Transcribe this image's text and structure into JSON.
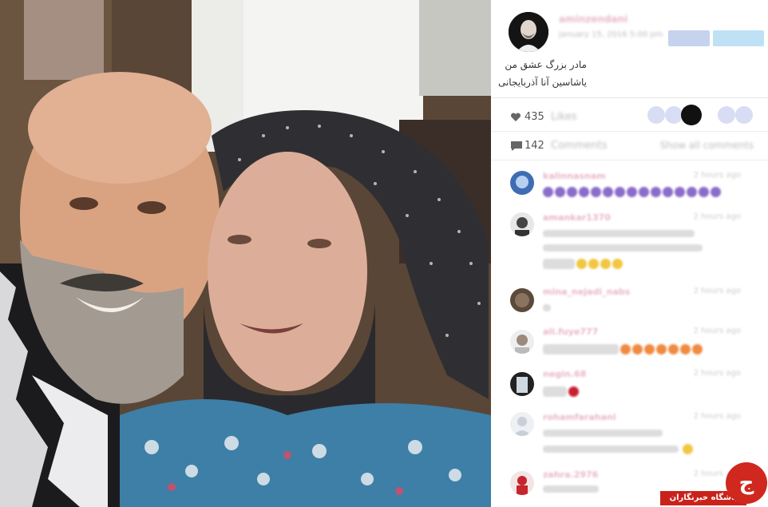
{
  "post": {
    "username": "aminzendani",
    "date": "January 15, 2016 5:00 pm",
    "caption": [
      "مادر بزرگ عشق من",
      "یاشاسین آنا آذربایجانی"
    ]
  },
  "stats": {
    "likes_count": "435",
    "likes_label": "Likes",
    "comments_count": "142",
    "comments_label": "Comments",
    "show_all_label": "Show all comments",
    "heart_icon": "heart-icon",
    "comment_icon": "comment-icon"
  },
  "comments": [
    {
      "username": "kalinnasnam",
      "time": "2 hours ago"
    },
    {
      "username": "amankar1370",
      "time": "2 hours ago"
    },
    {
      "username": "mina_nejadi_nabs",
      "time": "2 hours ago"
    },
    {
      "username": "ali.fuye777",
      "time": "2 hours ago"
    },
    {
      "username": "negin.68",
      "time": "2 hours ago"
    },
    {
      "username": "rohamfarahani",
      "time": "2 hours ago"
    },
    {
      "username": "zahra.2976",
      "time": "2 hours ago"
    }
  ],
  "watermark": {
    "logo_glyph": "ج",
    "text": "باشگاه خبرنگاران"
  },
  "colors": {
    "username_pink": "#e8b8c4",
    "brand_red": "#c9221b"
  }
}
